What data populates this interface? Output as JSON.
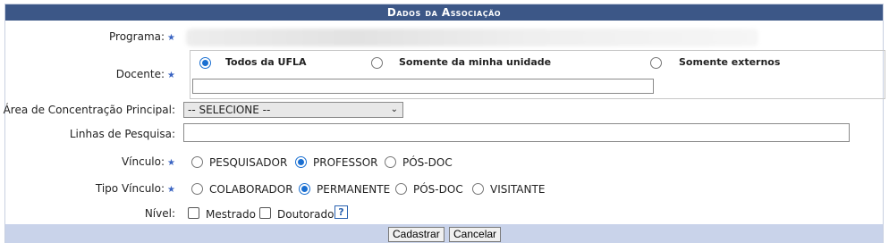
{
  "title": "Dados da Associação",
  "programa": {
    "label": "Programa:"
  },
  "docente": {
    "label": "Docente:",
    "options": [
      "Todos da UFLA",
      "Somente da minha unidade",
      "Somente externos"
    ],
    "selected": "Todos da UFLA",
    "input_value": ""
  },
  "area": {
    "label": "Área de Concentração Principal:",
    "selected": "-- SELECIONE --"
  },
  "linhas": {
    "label": "Linhas de Pesquisa:",
    "value": ""
  },
  "vinculo": {
    "label": "Vínculo:",
    "options": [
      "PESQUISADOR",
      "PROFESSOR",
      "PÓS-DOC"
    ],
    "selected": "PROFESSOR"
  },
  "tipo_vinculo": {
    "label": "Tipo Vínculo:",
    "options": [
      "COLABORADOR",
      "PERMANENTE",
      "PÓS-DOC",
      "VISITANTE"
    ],
    "selected": "PERMANENTE"
  },
  "nivel": {
    "label": "Nível:",
    "options": [
      "Mestrado",
      "Doutorado"
    ],
    "help": "?"
  },
  "buttons": {
    "submit": "Cadastrar",
    "cancel": "Cancelar"
  },
  "colors": {
    "title_bg": "#3c5787",
    "footer_bg": "#c9d3ea",
    "accent": "#1a6fd1"
  }
}
